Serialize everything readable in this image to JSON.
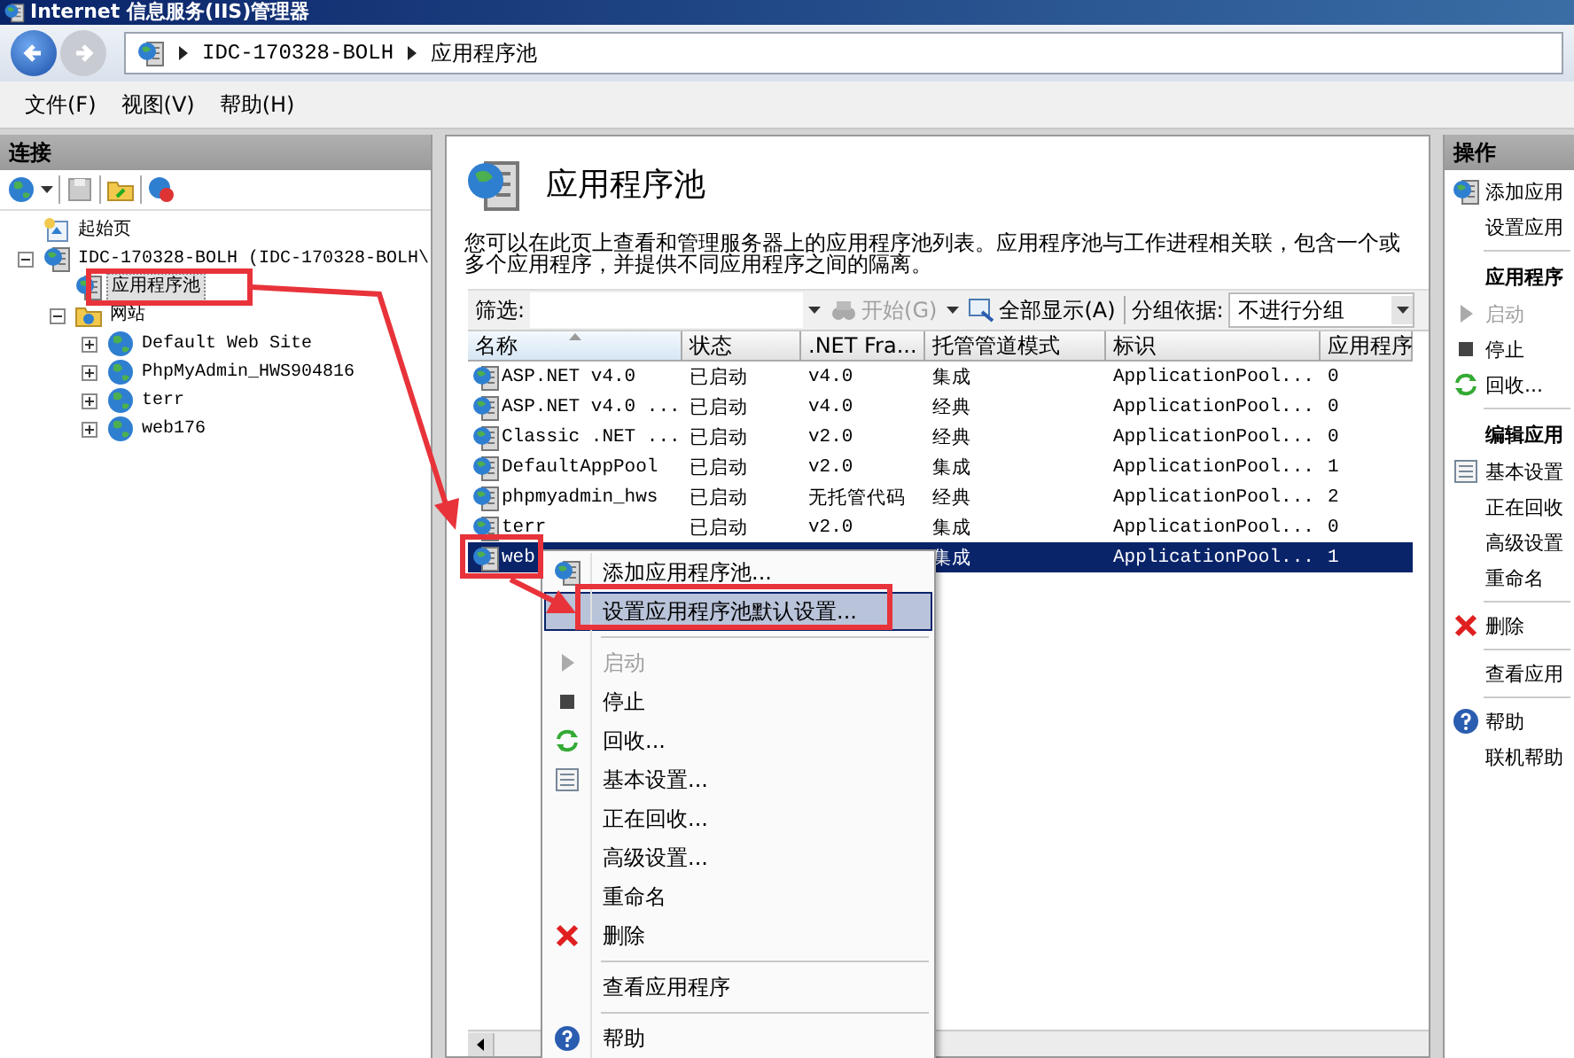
{
  "window": {
    "title": "Internet 信息服务(IIS)管理器"
  },
  "address_bar": {
    "path": [
      "IDC-170328-BOLH",
      "应用程序池"
    ]
  },
  "menu_bar": [
    "文件(F)",
    "视图(V)",
    "帮助(H)"
  ],
  "connections": {
    "title": "连接",
    "tree": [
      {
        "label": "起始页",
        "kind": "start",
        "selected": false
      },
      {
        "label": "IDC-170328-BOLH (IDC-170328-BOLH\\",
        "kind": "server",
        "expanded": true,
        "selected": false,
        "children": [
          {
            "label": "应用程序池",
            "kind": "pools",
            "selected": true
          },
          {
            "label": "网站",
            "kind": "sites",
            "expanded": true,
            "selected": false,
            "children": [
              {
                "label": "Default Web Site",
                "kind": "site",
                "expanded": false,
                "selected": false
              },
              {
                "label": "PhpMyAdmin_HWS904816",
                "kind": "site",
                "expanded": false,
                "selected": false
              },
              {
                "label": "terr",
                "kind": "site",
                "expanded": false,
                "selected": false
              },
              {
                "label": "web176",
                "kind": "site",
                "expanded": false,
                "selected": false
              }
            ]
          }
        ]
      }
    ]
  },
  "content": {
    "title": "应用程序池",
    "description": "您可以在此页上查看和管理服务器上的应用程序池列表。应用程序池与工作进程相关联，包含一个或多个应用程序，并提供不同应用程序之间的隔离。",
    "filter": {
      "label": "筛选:",
      "start_button": {
        "label": "开始(G)",
        "disabled": true
      },
      "show_all_button": "全部显示(A)",
      "group_by_label": "分组依据:",
      "group_by_value": "不进行分组"
    },
    "table": {
      "columns": [
        {
          "label": "名称",
          "sorted": true
        },
        {
          "label": "状态",
          "sorted": false
        },
        {
          "label": ".NET Fra...",
          "sorted": false
        },
        {
          "label": "托管管道模式",
          "sorted": false
        },
        {
          "label": "标识",
          "sorted": false
        },
        {
          "label": "应用程序",
          "sorted": false
        }
      ],
      "rows": [
        {
          "cells": [
            "ASP.NET v4.0",
            "已启动",
            "v4.0",
            "集成",
            "ApplicationPool...",
            "0"
          ],
          "selected": false
        },
        {
          "cells": [
            "ASP.NET v4.0 ...",
            "已启动",
            "v4.0",
            "经典",
            "ApplicationPool...",
            "0"
          ],
          "selected": false
        },
        {
          "cells": [
            "Classic .NET ...",
            "已启动",
            "v2.0",
            "经典",
            "ApplicationPool...",
            "0"
          ],
          "selected": false
        },
        {
          "cells": [
            "DefaultAppPool",
            "已启动",
            "v2.0",
            "集成",
            "ApplicationPool...",
            "1"
          ],
          "selected": false
        },
        {
          "cells": [
            "phpmyadmin_hws",
            "已启动",
            "无托管代码",
            "经典",
            "ApplicationPool...",
            "2"
          ],
          "selected": false
        },
        {
          "cells": [
            "terr",
            "已启动",
            "v2.0",
            "集成",
            "ApplicationPool...",
            "0"
          ],
          "selected": false
        },
        {
          "cells": [
            "web",
            null,
            null,
            "集成",
            "ApplicationPool...",
            "1"
          ],
          "selected": true
        }
      ]
    }
  },
  "context_menu": {
    "items": [
      {
        "kind": "add",
        "label": "添加应用程序池...",
        "selected": false,
        "disabled": false
      },
      {
        "kind": "plain",
        "label": "设置应用程序池默认设置...",
        "selected": true,
        "disabled": false
      },
      {
        "kind": "separator"
      },
      {
        "kind": "start",
        "label": "启动",
        "selected": false,
        "disabled": true
      },
      {
        "kind": "stop",
        "label": "停止",
        "selected": false,
        "disabled": false
      },
      {
        "kind": "recycle",
        "label": "回收...",
        "selected": false,
        "disabled": false
      },
      {
        "kind": "settings",
        "label": "基本设置...",
        "selected": false,
        "disabled": false
      },
      {
        "kind": "plain",
        "label": "正在回收...",
        "selected": false,
        "disabled": false
      },
      {
        "kind": "plain",
        "label": "高级设置...",
        "selected": false,
        "disabled": false
      },
      {
        "kind": "plain",
        "label": "重命名",
        "selected": false,
        "disabled": false
      },
      {
        "kind": "delete",
        "label": "删除",
        "selected": false,
        "disabled": false
      },
      {
        "kind": "separator"
      },
      {
        "kind": "plain",
        "label": "查看应用程序",
        "selected": false,
        "disabled": false
      },
      {
        "kind": "separator"
      },
      {
        "kind": "help",
        "label": "帮助",
        "selected": false,
        "disabled": false
      }
    ]
  },
  "actions": {
    "title": "操作",
    "items": [
      {
        "kind": "add",
        "label": "添加应用",
        "disabled": false
      },
      {
        "kind": "plain",
        "label": "设置应用",
        "disabled": false
      },
      {
        "kind": "separator"
      },
      {
        "kind": "heading",
        "label": "应用程序"
      },
      {
        "kind": "start",
        "label": "启动",
        "disabled": true
      },
      {
        "kind": "stop",
        "label": "停止",
        "disabled": false
      },
      {
        "kind": "recycle",
        "label": "回收...",
        "disabled": false
      },
      {
        "kind": "separator"
      },
      {
        "kind": "heading",
        "label": "编辑应用"
      },
      {
        "kind": "settings",
        "label": "基本设置",
        "disabled": false
      },
      {
        "kind": "plain",
        "label": "正在回收",
        "disabled": false
      },
      {
        "kind": "plain",
        "label": "高级设置",
        "disabled": false
      },
      {
        "kind": "plain",
        "label": "重命名",
        "disabled": false
      },
      {
        "kind": "separator"
      },
      {
        "kind": "delete",
        "label": "删除",
        "disabled": false
      },
      {
        "kind": "separator"
      },
      {
        "kind": "plain",
        "label": "查看应用",
        "disabled": false
      },
      {
        "kind": "separator"
      },
      {
        "kind": "help",
        "label": "帮助",
        "disabled": false
      },
      {
        "kind": "plain",
        "label": "联机帮助",
        "disabled": false
      }
    ]
  }
}
